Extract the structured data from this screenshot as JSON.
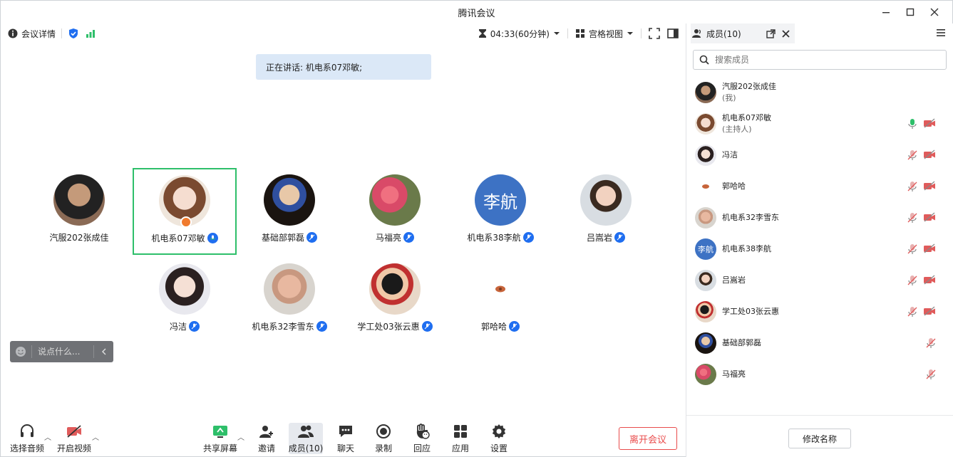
{
  "window": {
    "title": "腾讯会议"
  },
  "topbar": {
    "meeting_info": "会议详情",
    "timer": "04:33(60分钟)",
    "view_mode": "宫格视图"
  },
  "stage": {
    "speaking_label": "正在讲话: 机电系07邓敏;",
    "participants": [
      {
        "name": "汽服202张成佳",
        "mic": "none",
        "active": false
      },
      {
        "name": "机电系07邓敏",
        "mic": "on",
        "active": true
      },
      {
        "name": "基础部郭磊",
        "mic": "muted",
        "active": false
      },
      {
        "name": "马福亮",
        "mic": "muted",
        "active": false
      },
      {
        "name": "机电系38李航",
        "mic": "muted",
        "active": false,
        "avatar_text": "李航"
      },
      {
        "name": "吕嵩岩",
        "mic": "muted",
        "active": false
      },
      {
        "name": "冯洁",
        "mic": "muted",
        "active": false
      },
      {
        "name": "机电系32李雪东",
        "mic": "muted",
        "active": false
      },
      {
        "name": "学工处03张云惠",
        "mic": "muted",
        "active": false
      },
      {
        "name": "郭哈哈",
        "mic": "muted",
        "active": false
      }
    ],
    "chat_placeholder": "说点什么..."
  },
  "bottombar": {
    "audio": "选择音频",
    "video": "开启视频",
    "share": "共享屏幕",
    "invite": "邀请",
    "members": "成员(10)",
    "chat": "聊天",
    "record": "录制",
    "reactions": "回应",
    "apps": "应用",
    "settings": "设置",
    "leave": "离开会议"
  },
  "panel": {
    "tab_label": "成员(10)",
    "search_placeholder": "搜索成员",
    "members": [
      {
        "name": "汽服202张成佳",
        "sub": "(我)",
        "icons": []
      },
      {
        "name": "机电系07邓敏",
        "sub": "(主持人)",
        "icons": [
          "mic-on",
          "cam-off"
        ]
      },
      {
        "name": "冯洁",
        "sub": "",
        "icons": [
          "mic-off",
          "cam-off"
        ]
      },
      {
        "name": "郭哈哈",
        "sub": "",
        "icons": [
          "mic-off",
          "cam-off"
        ]
      },
      {
        "name": "机电系32李雪东",
        "sub": "",
        "icons": [
          "mic-off",
          "cam-off"
        ]
      },
      {
        "name": "机电系38李航",
        "sub": "",
        "icons": [
          "mic-off",
          "cam-off"
        ],
        "avatar_text": "李航"
      },
      {
        "name": "吕嵩岩",
        "sub": "",
        "icons": [
          "mic-off",
          "cam-off"
        ]
      },
      {
        "name": "学工处03张云惠",
        "sub": "",
        "icons": [
          "mic-off",
          "cam-off"
        ]
      },
      {
        "name": "基础部郭磊",
        "sub": "",
        "icons": [
          "mic-off"
        ]
      },
      {
        "name": "马福亮",
        "sub": "",
        "icons": [
          "mic-off"
        ]
      }
    ],
    "rename_button": "修改名称"
  },
  "colors": {
    "accent_blue": "#1f6ef0",
    "active_border": "#2ebf6a",
    "leave_red": "#e94b4b",
    "mic_green": "#2ebf6a",
    "muted_red": "#e05b5b"
  }
}
